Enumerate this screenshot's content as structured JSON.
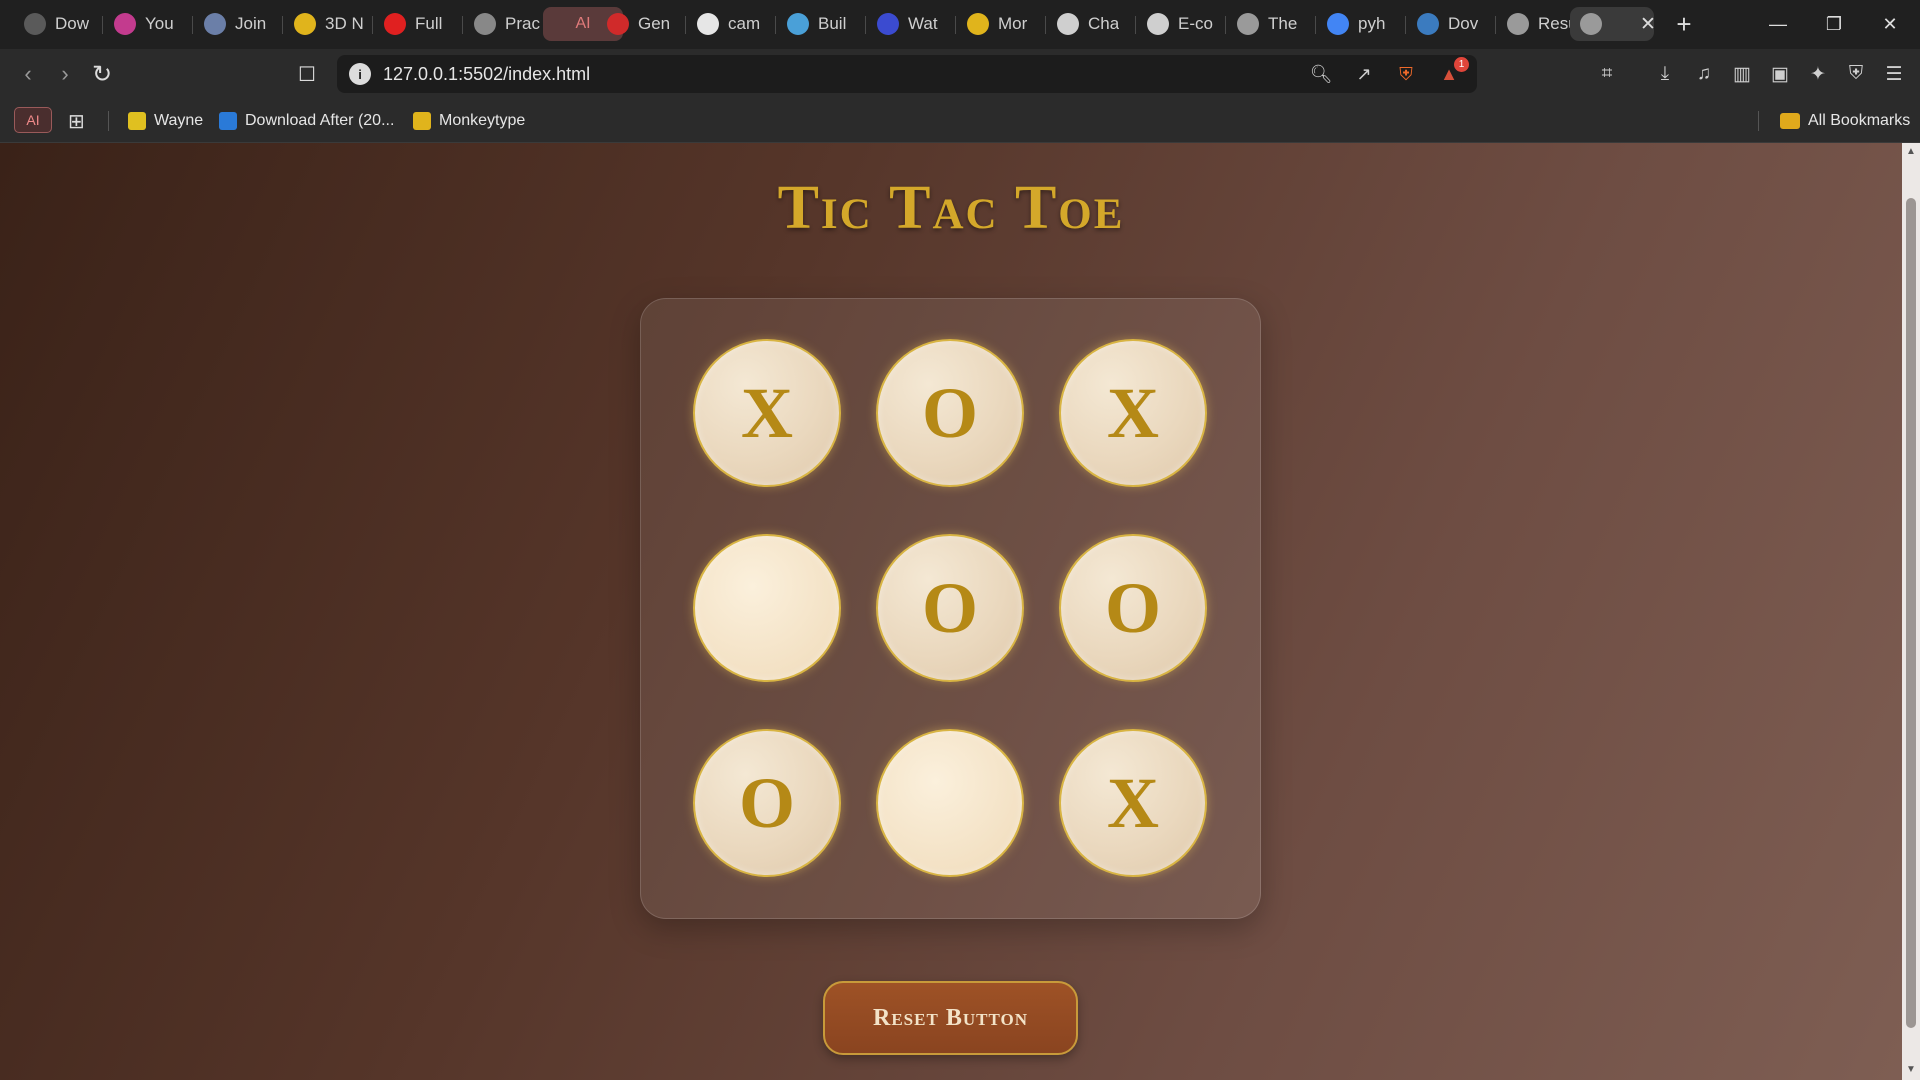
{
  "browser": {
    "tabs": [
      {
        "label": "Dow",
        "icon": "download-icon",
        "color": "#5a5a5a"
      },
      {
        "label": "You",
        "icon": "gmail-icon",
        "color": "#c33b8e"
      },
      {
        "label": "Join",
        "icon": "meet-icon",
        "color": "#6b7fa8"
      },
      {
        "label": "3D N",
        "icon": "3d-icon",
        "color": "#e0b41c"
      },
      {
        "label": "Full",
        "icon": "youtube-icon",
        "color": "#e02020"
      },
      {
        "label": "Prac",
        "icon": "practice-icon",
        "color": "#888888"
      },
      {
        "label": "AI",
        "icon": "ai-icon",
        "color": "#e07a7a"
      },
      {
        "label": "Gen",
        "icon": "gen-icon",
        "color": "#d02a2a"
      },
      {
        "label": "cam",
        "icon": "github-icon",
        "color": "#e6e6e6"
      },
      {
        "label": "Buil",
        "icon": "build-icon",
        "color": "#4aa0d8"
      },
      {
        "label": "Wat",
        "icon": "hashnode-icon",
        "color": "#3b4bd0"
      },
      {
        "label": "Mor",
        "icon": "monkeytype-icon",
        "color": "#e0b41c"
      },
      {
        "label": "Cha",
        "icon": "chatgpt-icon",
        "color": "#cfcfcf"
      },
      {
        "label": "E-co",
        "icon": "openai-icon",
        "color": "#cfcfcf"
      },
      {
        "label": "The",
        "icon": "globe-icon",
        "color": "#9a9a9a"
      },
      {
        "label": "pyh",
        "icon": "google-icon",
        "color": "#4285f4"
      },
      {
        "label": "Dov",
        "icon": "python-icon",
        "color": "#3b7bbf"
      },
      {
        "label": "Resu",
        "icon": "globe-icon",
        "color": "#9a9a9a"
      },
      {
        "label": "",
        "icon": "globe-icon",
        "color": "#9a9a9a"
      }
    ],
    "url": "127.0.0.1:5502/index.html",
    "notification_count": "1",
    "bookmarks_badge": "AI",
    "bookmarks": [
      {
        "label": "Wayne",
        "icon": "wayne-icon",
        "color": "#e0c020"
      },
      {
        "label": "Download After (20...",
        "icon": "download-after-icon",
        "color": "#2a7ad8"
      },
      {
        "label": "Monkeytype",
        "icon": "monkeytype-icon",
        "color": "#e0b41c"
      }
    ],
    "all_bookmarks": "All Bookmarks"
  },
  "game": {
    "title": "Tic Tac Toe",
    "board": [
      "X",
      "O",
      "X",
      "",
      "O",
      "O",
      "O",
      "",
      "X"
    ],
    "reset_label": "Reset Button"
  },
  "colors": {
    "accent_gold": "#d4a82a",
    "mark_color": "#b58916",
    "button_brown": "#9e5226"
  }
}
